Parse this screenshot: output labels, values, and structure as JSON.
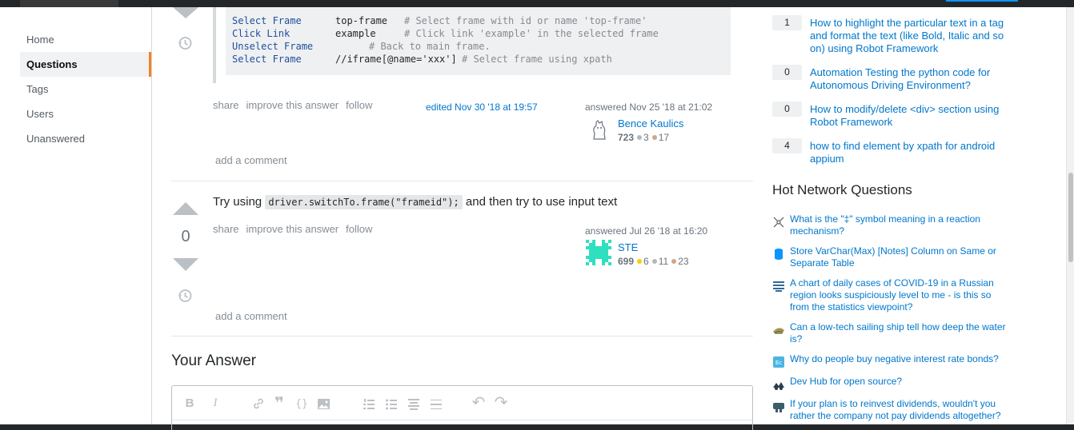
{
  "nav": {
    "items": [
      {
        "label": "Home",
        "active": false
      },
      {
        "label": "Questions",
        "active": true
      },
      {
        "label": "Tags",
        "active": false
      },
      {
        "label": "Users",
        "active": false
      },
      {
        "label": "Unanswered",
        "active": false
      }
    ]
  },
  "code_block": {
    "lines": [
      {
        "kw": "Select Frame",
        "arg": "top-frame",
        "comment": "# Select frame with id or name 'top-frame'"
      },
      {
        "kw": "Click Link",
        "arg": "example",
        "comment": "# Click link 'example' in the selected frame"
      },
      {
        "kw": "Unselect Frame",
        "arg": "",
        "comment": "# Back to main frame."
      },
      {
        "kw": "Select Frame",
        "arg": "//iframe[@name='xxx']",
        "comment": "# Select frame using xpath"
      }
    ]
  },
  "answer1": {
    "menu": {
      "share": "share",
      "improve": "improve this answer",
      "follow": "follow"
    },
    "edited": "edited Nov 30 '18 at 19:57",
    "answered": "answered Nov 25 '18 at 21:02",
    "user": {
      "name": "Bence Kaulics",
      "rep": "723",
      "silver": "3",
      "bronze": "17"
    },
    "add_comment": "add a comment"
  },
  "answer2": {
    "vote_count": "0",
    "text_before": "Try using",
    "code": "driver.switchTo.frame(\"frameid\");",
    "text_after": "and then try to use input text",
    "menu": {
      "share": "share",
      "improve": "improve this answer",
      "follow": "follow"
    },
    "answered": "answered Jul 26 '18 at 16:20",
    "user": {
      "name": "STE",
      "rep": "699",
      "gold": "6",
      "silver": "11",
      "bronze": "23"
    },
    "add_comment": "add a comment"
  },
  "your_answer": {
    "title": "Your Answer",
    "toolbar_icons": [
      "bold-icon",
      "italic-icon",
      "link-icon",
      "quote-icon",
      "code-icon",
      "image-icon",
      "ordered-list-icon",
      "bulleted-list-icon",
      "heading-icon",
      "horizontal-rule-icon",
      "undo-icon",
      "redo-icon"
    ]
  },
  "related": [
    {
      "count": "1",
      "title": "How to highlight the particular text in a tag and format the text (like Bold, Italic and so on) using Robot Framework"
    },
    {
      "count": "0",
      "title": "Automation Testing the python code for Autonomous Driving Environment?"
    },
    {
      "count": "0",
      "title": "How to modify/delete <div> section using Robot Framework"
    },
    {
      "count": "4",
      "title": "how to find element by xpath for android appium"
    }
  ],
  "hot_network": {
    "title": "Hot Network Questions",
    "items": [
      {
        "icon": "chemistry-icon",
        "title": "What is the \"‡\" symbol meaning in a reaction mechanism?"
      },
      {
        "icon": "database-icon",
        "title": "Store VarChar(Max) [Notes] Column on Same or Separate Table"
      },
      {
        "icon": "statistics-icon",
        "title": "A chart of daily cases of COVID-19 in a Russian region looks suspiciously level to me - is this so from the statistics viewpoint?"
      },
      {
        "icon": "history-icon",
        "title": "Can a low-tech sailing ship tell how deep the water is?"
      },
      {
        "icon": "economics-icon",
        "title": "Why do people buy negative interest rate bonds?"
      },
      {
        "icon": "softwarerecs-icon",
        "title": "Dev Hub for open source?"
      },
      {
        "icon": "money-icon",
        "title": "If your plan is to reinvest dividends, wouldn't you rather the company not pay dividends altogether?"
      }
    ]
  },
  "colors": {
    "accent": "#f48024",
    "link": "#0077cc",
    "vote_arrow": "#bbc0c4"
  }
}
